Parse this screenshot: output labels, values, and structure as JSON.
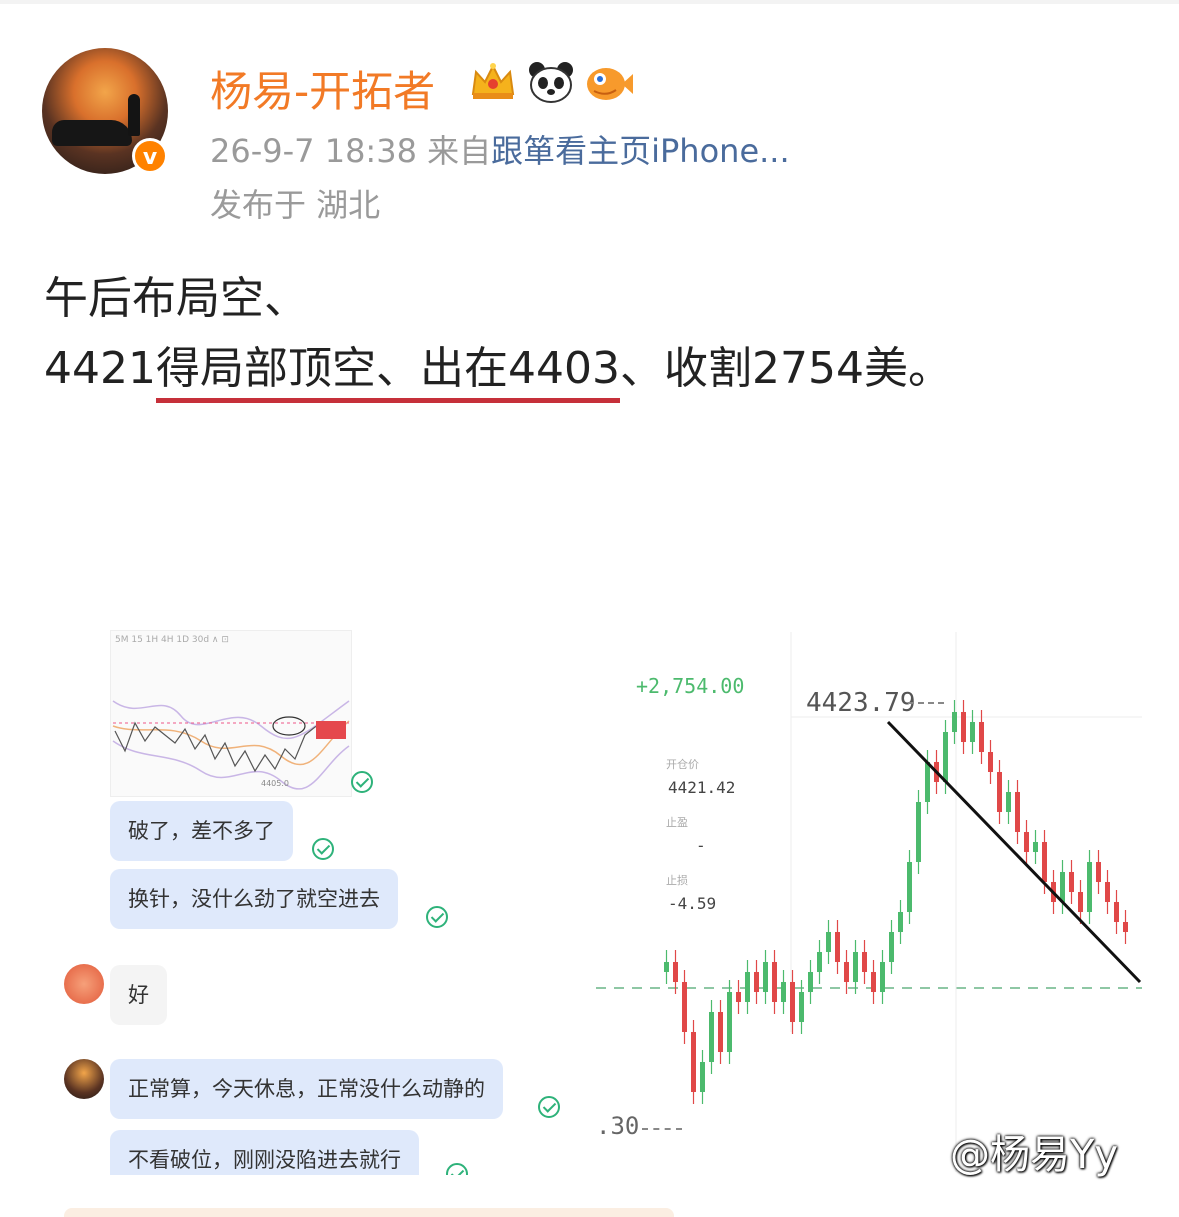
{
  "post": {
    "username": "杨易-开拓者",
    "verified_mark": "v",
    "badges": [
      "crown-icon",
      "panda-icon",
      "pufferfish-icon"
    ],
    "timestamp": "26-9-7 18:38",
    "source_prefix": "来自",
    "source": "跟箪看主页iPhone...",
    "location": "发布于 湖北",
    "text_line1": "午后布局空、",
    "text_line2_a": "4421",
    "text_line2_underlined": "得局部顶空、出在4403",
    "text_line2_b": "、收割2754美。"
  },
  "chat": {
    "messages": [
      {
        "text": "破了，差不多了",
        "side": "self"
      },
      {
        "text": "换针，没什么劲了就空进去",
        "side": "self"
      },
      {
        "text": "好",
        "side": "other"
      },
      {
        "text": "正常算，今天休息，正常没什么动静的",
        "side": "self"
      },
      {
        "text": "不看破位，刚刚没陷进去就行",
        "side": "self"
      }
    ],
    "minichart_toolbar": "5M  15  1H  4H  1D  30d  ∧  ⊡",
    "minichart_low": "4405.0"
  },
  "trade_chart": {
    "pnl": "+2,754.00",
    "open_label": "开仓价",
    "open_price": "4421.42",
    "tp_label": "止盈",
    "tp_value": "-",
    "sl_label": "止损",
    "sl_value": "-4.59",
    "high_label": "4423.79",
    "low_label": ".30"
  },
  "watermark": "@杨易Yy",
  "colors": {
    "username": "#f27a26",
    "verified": "#ff8200",
    "link": "#4a6b9c",
    "underline": "#c6303a",
    "candle_up": "#4cba6d",
    "candle_down": "#e04848"
  }
}
